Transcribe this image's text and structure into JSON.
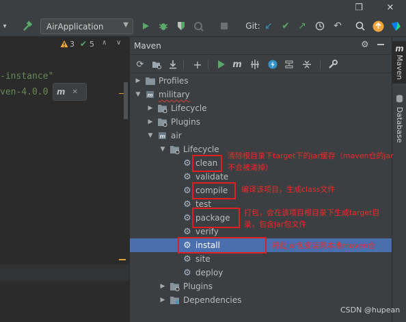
{
  "window": {
    "restore_icon": "❐",
    "close_icon": "✕"
  },
  "toolbar": {
    "run_config": "AirApplication",
    "git_label": "Git:"
  },
  "editor": {
    "inspection_warnings": "3",
    "inspection_checks": "5",
    "code_lines": [
      "-instance\"",
      "ven-4.0.0"
    ]
  },
  "maven": {
    "panel_title": "Maven",
    "side_tab_maven": "Maven",
    "side_tab_database": "Database",
    "tree": {
      "profiles": "Profiles",
      "military": "military",
      "military_lifecycle": "Lifecycle",
      "military_plugins": "Plugins",
      "air": "air",
      "air_lifecycle": "Lifecycle",
      "goals": [
        "clean",
        "validate",
        "compile",
        "test",
        "package",
        "verify",
        "install",
        "site",
        "deploy"
      ],
      "air_plugins": "Plugins",
      "air_dependencies": "Dependencies"
    }
  },
  "annotations": {
    "clean_note": "清除根目录下target下的jar缓存（maven仓的jar不会被清掉）",
    "compile_note": "编译该项目，生成class文件",
    "package_note": "打包，会在该项目根目录下生成target目录，包含jar包文件",
    "install_note": "将此jar包安装到本地maven仓"
  },
  "watermark": "CSDN @hupean",
  "colors": {
    "accent_selection": "#4b6eaf",
    "annotation_red": "#e02020",
    "run_green": "#59a869"
  }
}
